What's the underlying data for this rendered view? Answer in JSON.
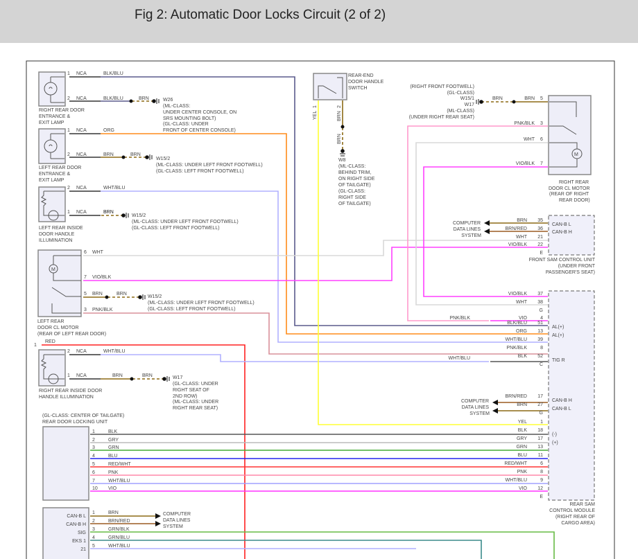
{
  "title": "Fig 2: Automatic Door Locks Circuit (2 of 2)",
  "colors": {
    "BLK/BLU": "#5a5a8c",
    "ORG": "#ff8c1a",
    "WHT/BLU": "#b0b0ff",
    "BRN": "#8b6914",
    "WHT": "#d8d8d8",
    "VIO/BLK": "#ff40ff",
    "PNK/BLK": "#f59ac0",
    "RED": "#ff2020",
    "YEL": "#ffff33",
    "BLK": "#555555",
    "GRY": "#bbbbbb",
    "GRN": "#44aa33",
    "BLU": "#2222ee",
    "RED/WHT": "#ff3333",
    "PNK": "#ff88aa",
    "VIO": "#ff33ff",
    "GRN/BLK": "#66bb44",
    "GRN/BLU": "#3a8a8a"
  },
  "left": {
    "rr_lamp": {
      "name": [
        "RIGHT REAR DOOR",
        "ENTRANCE &",
        "EXIT LAMP"
      ],
      "p1": "1",
      "p2": "2",
      "nca": "NCA",
      "w1": "BLK/BLU",
      "w2": "BLK/BLU",
      "w2b": "BRN",
      "ground": [
        "W26",
        "(ML-CLASS:",
        "UNDER CENTER CONSOLE, ON",
        "SRS MOUNTING BOLT)",
        "(GL-CLASS: UNDER",
        "FRONT OF CENTER CONSOLE)"
      ]
    },
    "lr_lamp": {
      "name": [
        "LEFT REAR DOOR",
        "ENTRANCE &",
        "EXIT LAMP"
      ],
      "p1": "1",
      "p2": "2",
      "nca": "NCA",
      "w1": "ORG",
      "w2": "BRN",
      "w2b": "BRN",
      "ground": [
        "W15/2",
        "(ML-CLASS: UNDER LEFT FRONT FOOTWELL)",
        "(GL-CLASS: LEFT FRONT FOOTWELL)"
      ]
    },
    "lr_handle": {
      "name": [
        "LEFT REAR INSIDE",
        "DOOR HANDLE",
        "ILLUMINATION"
      ],
      "p1": "2",
      "p2": "1",
      "nca": "NCA",
      "w1": "WHT/BLU",
      "w2": "BRN",
      "ground": [
        "W15/2",
        "(ML-CLASS: UNDER LEFT FRONT FOOTWELL)",
        "(GL-CLASS: LEFT FRONT FOOTWELL)"
      ]
    },
    "lr_motor": {
      "name": [
        "LEFT REAR",
        "DOOR CL MOTOR",
        "(REAR OF LEFT REAR DOOR)"
      ],
      "pins": [
        {
          "n": "6",
          "w": "WHT"
        },
        {
          "n": "7",
          "w": "VIO/BLK"
        },
        {
          "n": "5",
          "w": "BRN"
        },
        {
          "n": "3",
          "w": "PNK/BLK"
        }
      ],
      "w5b": "BRN",
      "ground": [
        "W15/2",
        "(ML-CLASS: UNDER LEFT FRONT FOOTWELL)",
        "(GL-CLASS: LEFT FRONT FOOTWELL)"
      ]
    },
    "red": {
      "n": "1",
      "w": "RED"
    },
    "rr_handle": {
      "name": [
        "RIGHT REAR INSIDE DOOR",
        "HANDLE ILLUMINATION"
      ],
      "p1": "2",
      "p2": "1",
      "nca": "NCA",
      "w1": "WHT/BLU",
      "w2": "BRN",
      "w2b": "BRN",
      "ground": [
        "W17",
        "(GL-CLASS: UNDER",
        "RIGHT SEAT OF",
        "2ND ROW)",
        "(ML-CLASS: UNDER",
        "RIGHT REAR SEAT)"
      ]
    },
    "lock_unit": {
      "name": [
        "(GL-CLASS: CENTER OF TAILGATE)",
        "REAR DOOR LOCKING UNIT"
      ],
      "pins": [
        {
          "n": "1",
          "w": "BLK"
        },
        {
          "n": "2",
          "w": "GRY"
        },
        {
          "n": "3",
          "w": "GRN"
        },
        {
          "n": "4",
          "w": "BLU"
        },
        {
          "n": "5",
          "w": "RED/WHT"
        },
        {
          "n": "6",
          "w": "PNK"
        },
        {
          "n": "7",
          "w": "WHT/BLU"
        },
        {
          "n": "10",
          "w": "VIO"
        }
      ]
    },
    "bottom_unit": {
      "pins": [
        {
          "t": "CAN-B L",
          "n": "1",
          "w": "BRN"
        },
        {
          "t": "CAN-B H",
          "n": "2",
          "w": "BRN/RED"
        },
        {
          "t": "SIG",
          "n": "3",
          "w": "GRN/BLK"
        },
        {
          "t": "EKS 1",
          "n": "4",
          "w": "GRN/BLU"
        },
        {
          "t": "21",
          "n": "5",
          "w": "WHT/BLU"
        }
      ],
      "target": [
        "COMPUTER",
        "DATA LINES",
        "SYSTEM"
      ]
    }
  },
  "center": {
    "switch": {
      "name": [
        "REAR-END",
        "DOOR HANDLE",
        "SWITCH"
      ],
      "p1": "1",
      "w1": "YEL",
      "p2": "2",
      "w2": "BRN",
      "w2b": "BRN",
      "ground": [
        "W8",
        "(ML-CLASS:",
        "BEHIND TRIM,",
        "ON RIGHT SIDE",
        "OF TAILGATE)",
        "(GL-CLASS:",
        "RIGHT SIDE",
        "OF TAILGATE)"
      ]
    }
  },
  "right": {
    "rr_motor": {
      "name": [
        "RIGHT REAR",
        "DOOR CL MOTOR",
        "(REAR OF RIGHT",
        "REAR DOOR)"
      ],
      "ground": [
        "(RIGHT FRONT FOOTWELL)",
        "(GL-CLASS)",
        "W15/1",
        "W17",
        "(ML-CLASS)",
        "(UNDER RIGHT REAR SEAT)"
      ],
      "pins": [
        {
          "n": "5",
          "w": "BRN",
          "wb": "BRN"
        },
        {
          "n": "3",
          "w": "PNK/BLK"
        },
        {
          "n": "6",
          "w": "WHT"
        },
        {
          "n": "7",
          "w": "VIO/BLK"
        }
      ]
    },
    "front_sam": {
      "name": [
        "FRONT SAM CONTROL UNIT",
        "(UNDER FRONT",
        "PASSENGER'S SEAT)"
      ],
      "target": [
        "COMPUTER",
        "DATA LINES",
        "SYSTEM"
      ],
      "pins": [
        {
          "n": "35",
          "w": "BRN",
          "t": "CAN-B L"
        },
        {
          "n": "36",
          "w": "BRN/RED",
          "t": "CAN-B H"
        },
        {
          "n": "21",
          "w": "WHT"
        },
        {
          "n": "22",
          "w": "VIO/BLK"
        }
      ],
      "conn": "E"
    },
    "rear_sam": {
      "name": [
        "REAR SAM",
        "CONTROL MODULE",
        "(RIGHT REAR OF",
        "CARGO AREA)"
      ],
      "target": [
        "COMPUTER",
        "DATA LINES",
        "SYSTEM"
      ],
      "pnk_in": "PNK/BLK",
      "whtblu_in": "WHT/BLU",
      "pins": [
        {
          "n": "37",
          "w": "VIO/BLK"
        },
        {
          "n": "38",
          "w": "WHT"
        },
        {
          "n": "G"
        },
        {
          "n": "4",
          "w": "VIO"
        },
        {
          "n": "51",
          "w": "BLK/BLU",
          "t": "AL(+)"
        },
        {
          "n": "13",
          "w": "ORG",
          "t": "AL(+)"
        },
        {
          "n": "39",
          "w": "WHT/BLU"
        },
        {
          "n": "8",
          "w": "PNK/BLK"
        },
        {
          "n": "52",
          "w": "BLK",
          "t": "TIG R"
        },
        {
          "n": "C"
        },
        {
          "n": "17",
          "w": "BRN/RED",
          "t": "CAN-B H"
        },
        {
          "n": "27",
          "w": "BRN",
          "t": "CAN-B L"
        },
        {
          "n": "G"
        },
        {
          "n": "1",
          "w": "YEL"
        },
        {
          "n": "18",
          "w": "BLK",
          "t": "(-)"
        },
        {
          "n": "17",
          "w": "GRY",
          "t": "(+)"
        },
        {
          "n": "13",
          "w": "GRN"
        },
        {
          "n": "11",
          "w": "BLU"
        },
        {
          "n": "6",
          "w": "RED/WHT"
        },
        {
          "n": "8",
          "w": "PNK"
        },
        {
          "n": "9",
          "w": "WHT/BLU"
        },
        {
          "n": "12",
          "w": "VIO"
        },
        {
          "n": "E"
        }
      ]
    }
  }
}
